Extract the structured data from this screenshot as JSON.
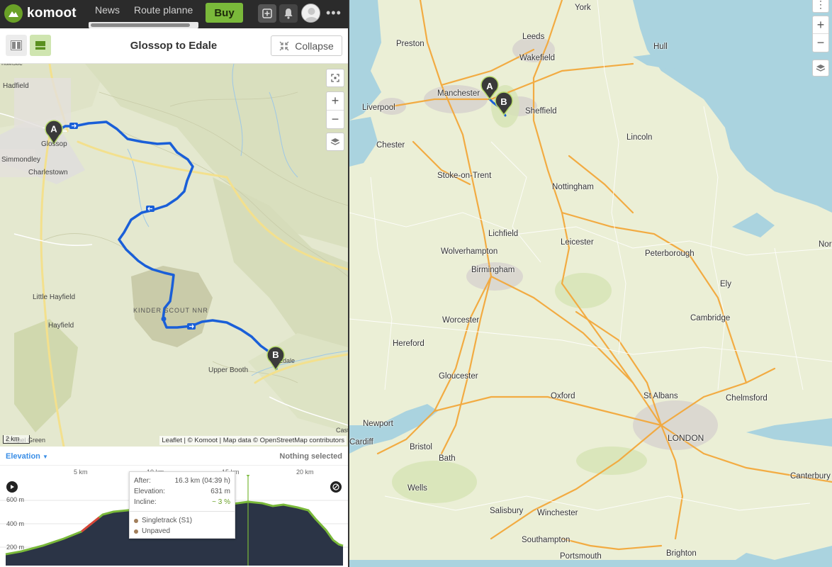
{
  "app": {
    "brand": "komoot"
  },
  "nav": {
    "news": "News",
    "route_planner": "Route planne",
    "buy": "Buy"
  },
  "tour": {
    "title": "Glossop to Edale",
    "collapse_label": "Collapse"
  },
  "left_map": {
    "places": {
      "hadfield": "Hadfield",
      "glossop": "Glossop",
      "simmondley": "Simmondley",
      "charlestown": "Charlestown",
      "little_hayfield": "Little Hayfield",
      "hayfield": "Hayfield",
      "kinder_scout": "KINDER SCOUT NNR",
      "upper_booth": "Upper Booth",
      "edale": "Edale",
      "chinley": "Chapel Green",
      "castleton": "Cast",
      "tintwistle": "ntwistle"
    },
    "markers": {
      "start": "A",
      "end": "B"
    },
    "scale": "2 km",
    "attribution": "Leaflet | © Komoot | Map data © OpenStreetMap contributors"
  },
  "elevation": {
    "title": "Elevation",
    "selection_status": "Nothing selected",
    "km_ticks": [
      "5 km",
      "10 km",
      "15 km",
      "20 km"
    ],
    "alt_labels": [
      "600 m",
      "400 m",
      "200 m"
    ],
    "tooltip": {
      "after_label": "After:",
      "after_value": "16.3 km (04:39 h)",
      "elevation_label": "Elevation:",
      "elevation_value": "631 m",
      "incline_label": "Incline:",
      "incline_value": "~ 3 %",
      "surface_1": "Singletrack (S1)",
      "surface_2": "Unpaved"
    }
  },
  "overview_map": {
    "cities": {
      "york": "York",
      "leeds": "Leeds",
      "wakefield": "Wakefield",
      "hull": "Hull",
      "preston": "Preston",
      "manchester": "Manchester",
      "liverpool": "Liverpool",
      "sheffield": "Sheffield",
      "chester": "Chester",
      "lincoln": "Lincoln",
      "stoke": "Stoke-on-Trent",
      "nottingham": "Nottingham",
      "lichfield": "Lichfield",
      "wolverhampton": "Wolverhampton",
      "leicester": "Leicester",
      "peterborough": "Peterborough",
      "birmingham": "Birmingham",
      "norwich": "Nor",
      "ely": "Ely",
      "worcester": "Worcester",
      "cambridge": "Cambridge",
      "hereford": "Hereford",
      "gloucester": "Gloucester",
      "oxford": "Oxford",
      "st_albans": "St Albans",
      "chelmsford": "Chelmsford",
      "newport": "Newport",
      "cardiff": "Cardiff",
      "bristol": "Bristol",
      "london": "LONDON",
      "bath": "Bath",
      "canterbury": "Canterbury",
      "wells": "Wells",
      "salisbury": "Salisbury",
      "winchester": "Winchester",
      "southampton": "Southampton",
      "portsmouth": "Portsmouth",
      "brighton": "Brighton"
    },
    "markers": {
      "start": "A",
      "end": "B"
    }
  },
  "colors": {
    "brand_green": "#6aa127",
    "buy_button": "#7ab93a",
    "route": "#1a5fd8",
    "road": "#f3a83b",
    "sea": "#aad3df",
    "elevation_fill": "#2b3446",
    "elevation_line": "#7ab93a"
  }
}
